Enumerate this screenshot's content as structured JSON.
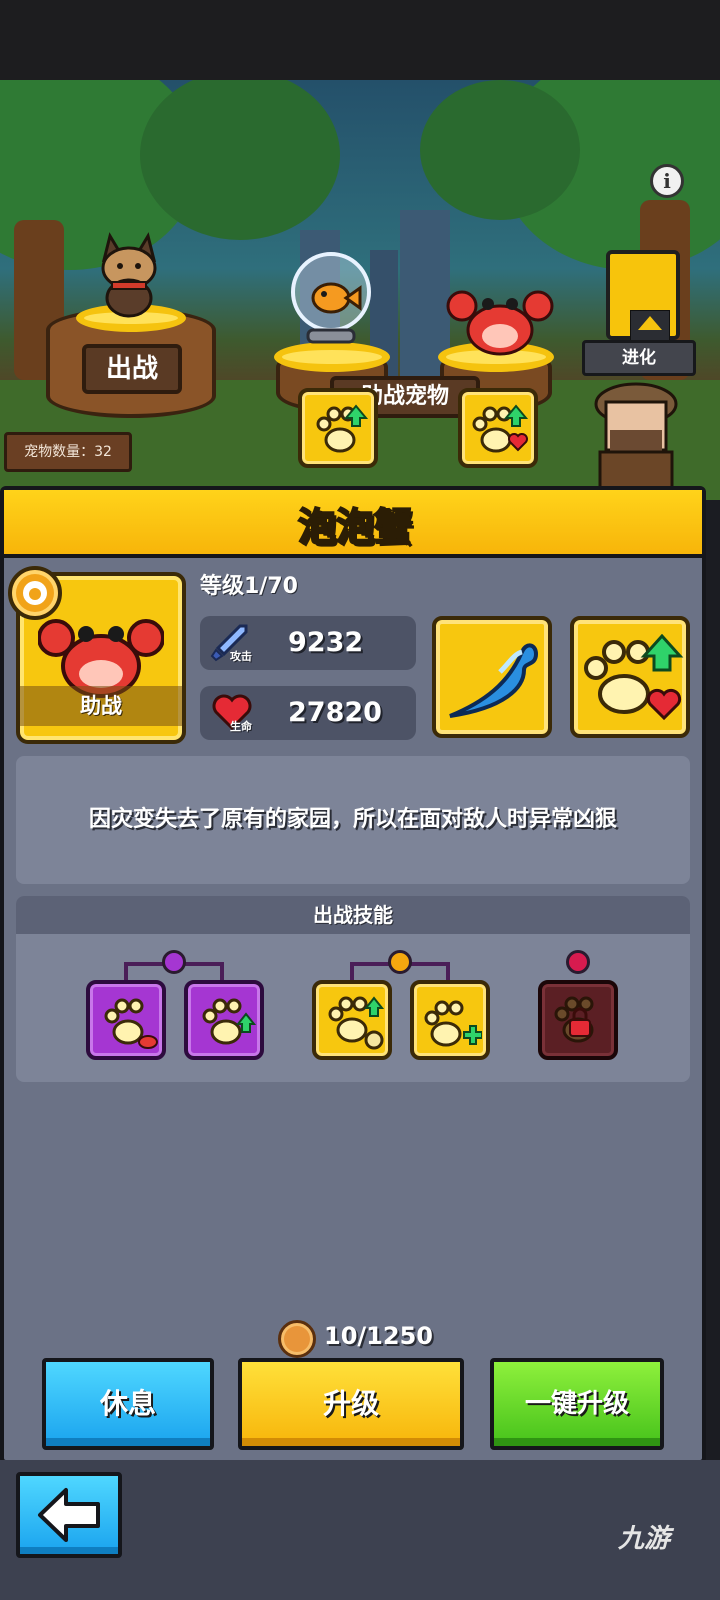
{
  "scene": {
    "deploy_sign": "出战",
    "support_sign": "助战宠物",
    "evolve_label": "进化",
    "pet_count_label": "宠物数量：32",
    "info_icon": "i"
  },
  "pet": {
    "name": "泡泡蟹",
    "level": "等级1/70",
    "role_label": "助战",
    "attack_tag": "攻击",
    "attack_value": "9232",
    "hp_tag": "生命",
    "hp_value": "27820",
    "description": "因灾变失去了原有的家园，所以在面对敌人时异常凶狠"
  },
  "skills": {
    "header": "出战技能"
  },
  "cost": {
    "text": "10/1250"
  },
  "buttons": {
    "rest": "休息",
    "upgrade": "升级",
    "auto_upgrade": "一键升级"
  },
  "watermark": "九游",
  "colors": {
    "title_yellow": "#f7c70f",
    "panel_gray": "#6b7286",
    "rest_blue": "#1aa3ee",
    "auto_green": "#46c21b",
    "purple_tier": "#a536d2",
    "orange_tier": "#f5a70f",
    "red_tier": "#d81b4f"
  }
}
